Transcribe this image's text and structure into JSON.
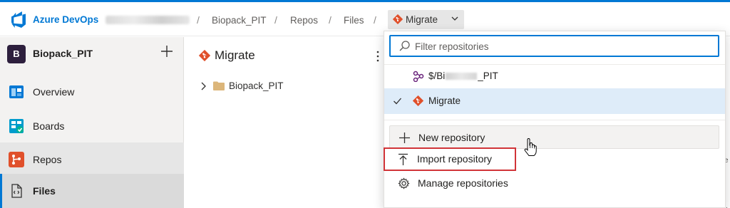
{
  "header": {
    "brand": "Azure DevOps",
    "breadcrumbs": [
      "Biopack_PIT",
      "Repos",
      "Files"
    ],
    "current_repo": "Migrate",
    "separator": "/"
  },
  "sidebar": {
    "project_initial": "B",
    "project_name": "Biopack_PIT",
    "items": [
      {
        "label": "Overview",
        "icon": "overview-icon"
      },
      {
        "label": "Boards",
        "icon": "boards-icon"
      },
      {
        "label": "Repos",
        "icon": "repos-icon"
      },
      {
        "label": "Files",
        "icon": "files-icon"
      }
    ]
  },
  "main": {
    "repo_title": "Migrate",
    "tree": [
      {
        "label": "Biopack_PIT",
        "icon": "folder-icon"
      }
    ]
  },
  "dropdown": {
    "filter_placeholder": "Filter repositories",
    "repos": [
      {
        "label_prefix": "$/Bi",
        "label_suffix": "_PIT",
        "icon": "tfvc-icon",
        "selected": false
      },
      {
        "label": "Migrate",
        "icon": "git-icon",
        "selected": true
      }
    ],
    "actions": [
      {
        "label": "New repository",
        "icon": "plus-icon"
      },
      {
        "label": "Import repository",
        "icon": "import-icon"
      },
      {
        "label": "Manage repositories",
        "icon": "gear-icon"
      }
    ]
  },
  "right_strip": {
    "char1": "e",
    "char2": "."
  },
  "colors": {
    "accent": "#0078d4",
    "git": "#e0502b",
    "highlight": "#d13438",
    "selected_bg": "#deecf9"
  }
}
